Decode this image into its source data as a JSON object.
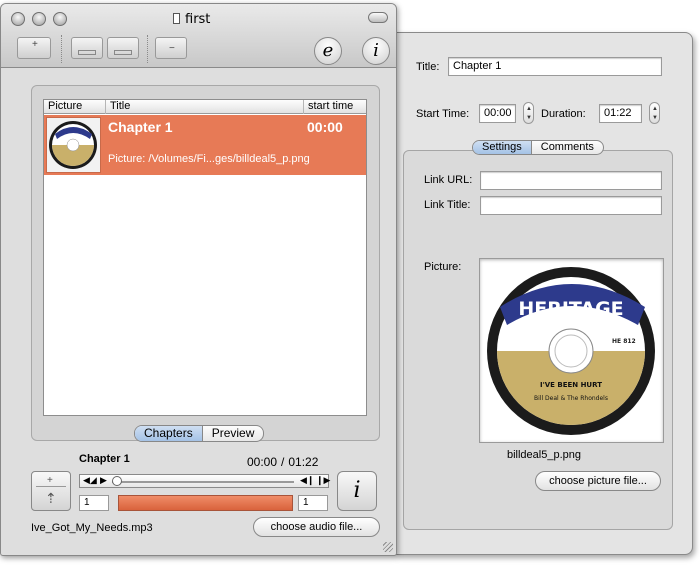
{
  "window": {
    "title": "first"
  },
  "toolbar": {
    "edit_label": "e",
    "info_label": "i"
  },
  "table": {
    "headers": [
      "Picture",
      "Title",
      "start time"
    ],
    "rows": [
      {
        "title": "Chapter 1",
        "start": "00:00",
        "picture": "Picture: /Volumes/Fi...ges/billdeal5_p.png"
      }
    ]
  },
  "main_tabs": [
    "Chapters",
    "Preview"
  ],
  "player": {
    "chapter": "Chapter 1",
    "current_time": "00:00",
    "separator": "/",
    "total_time": "01:22",
    "field_left": "1",
    "field_right": "1",
    "info_label": "i",
    "file_name": "Ive_Got_My_Needs.mp3",
    "choose_audio_label": "choose audio file..."
  },
  "drawer": {
    "title_label": "Title:",
    "title_value": "Chapter 1",
    "start_label": "Start Time:",
    "start_value": "00:00",
    "duration_label": "Duration:",
    "duration_value": "01:22",
    "tabs": [
      "Settings",
      "Comments"
    ],
    "link_url_label": "Link URL:",
    "link_url_value": "",
    "link_title_label": "Link Title:",
    "link_title_value": "",
    "picture_label": "Picture:",
    "picture_name": "billdeal5_p.png",
    "choose_picture_label": "choose picture file..."
  },
  "record_label": {
    "brand": "HERITAGE",
    "song": "I'VE BEEN HURT",
    "artist": "Bill Deal & The Rhondels",
    "catalog": "HE 812"
  },
  "colors": {
    "selection": "#e77a56",
    "segment_selected": "#a4c2e6"
  }
}
